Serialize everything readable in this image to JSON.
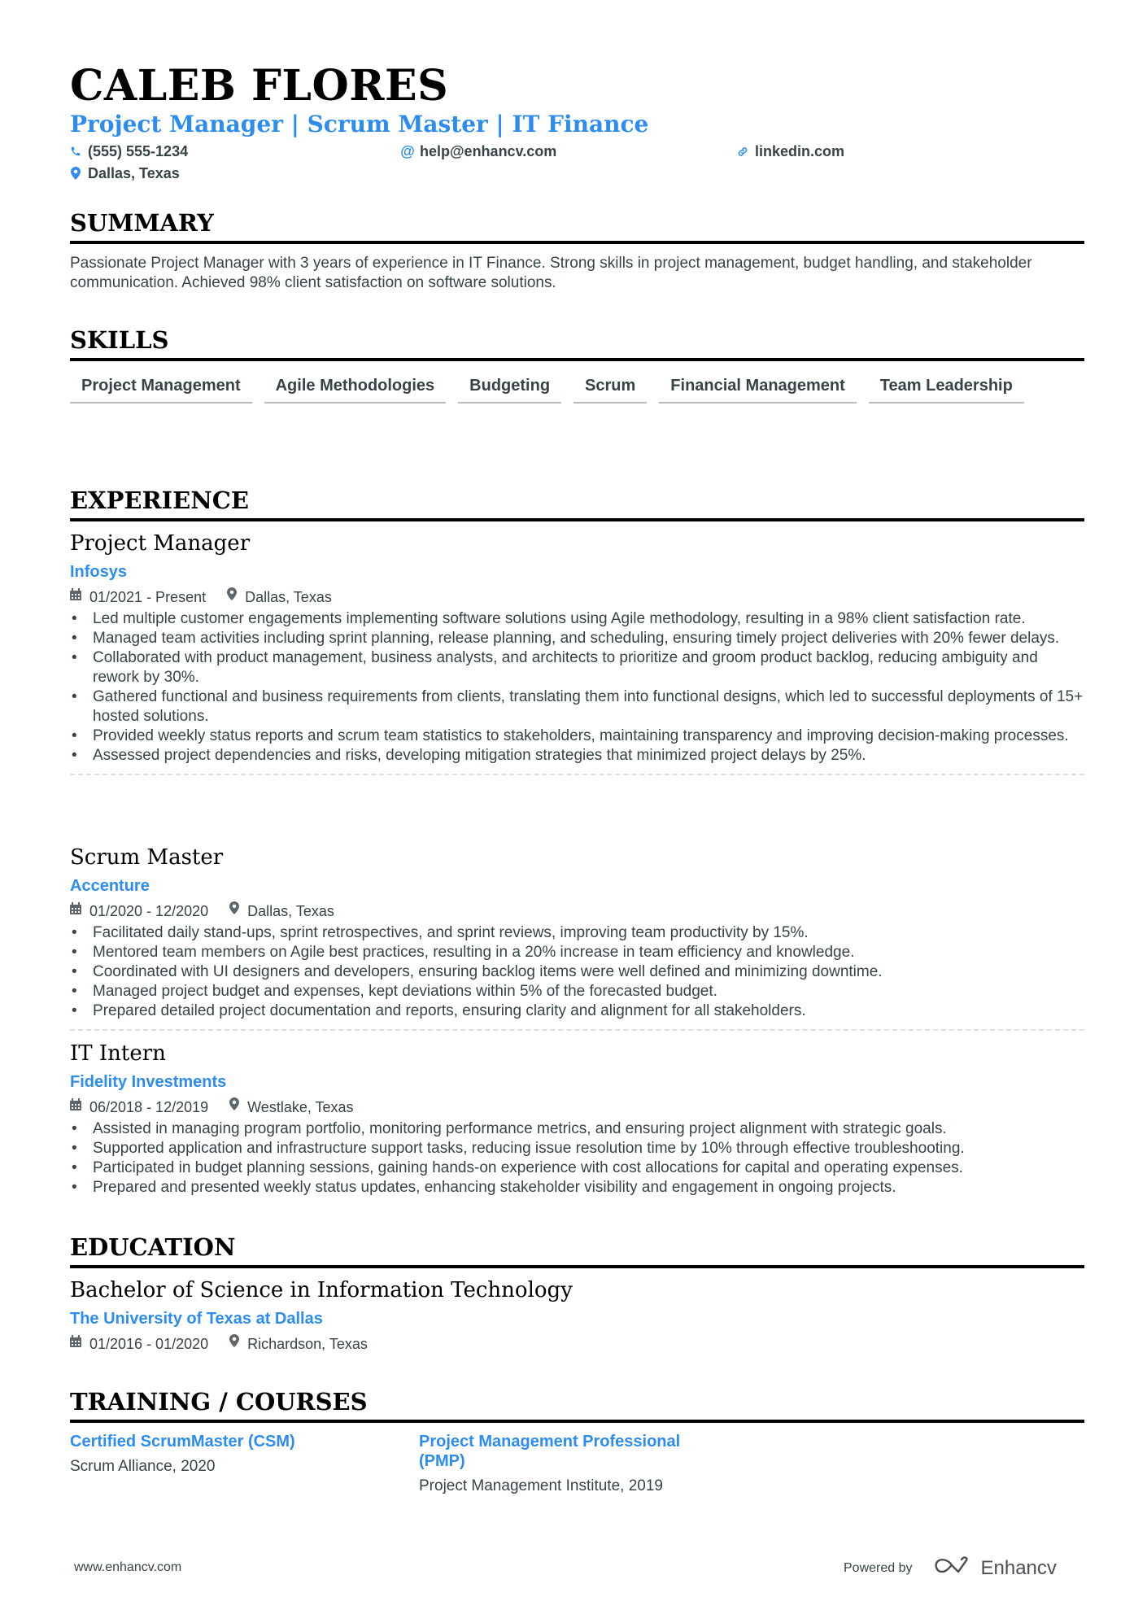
{
  "header": {
    "name": "CALEB FLORES",
    "title": "Project Manager | Scrum Master | IT Finance",
    "contacts": {
      "phone": "(555) 555-1234",
      "email": "help@enhancv.com",
      "linkedin": "linkedin.com",
      "location": "Dallas, Texas"
    }
  },
  "colors": {
    "accent": "#2d8cf0",
    "heading": "#000000",
    "text": "#384347"
  },
  "summary": {
    "heading": "SUMMARY",
    "text": "Passionate Project Manager with 3 years of experience in IT Finance. Strong skills in project management, budget handling, and stakeholder communication. Achieved 98% client satisfaction on software solutions."
  },
  "skills": {
    "heading": "SKILLS",
    "items": [
      "Project Management",
      "Agile Methodologies",
      "Budgeting",
      "Scrum",
      "Financial Management",
      "Team Leadership"
    ]
  },
  "experience": {
    "heading": "EXPERIENCE",
    "jobs": [
      {
        "title": "Project Manager",
        "company": "Infosys",
        "dates": "01/2021 - Present",
        "location": "Dallas, Texas",
        "bullets": [
          "Led multiple customer engagements implementing software solutions using Agile methodology, resulting in a 98% client satisfaction rate.",
          "Managed team activities including sprint planning, release planning, and scheduling, ensuring timely project deliveries with 20% fewer delays.",
          "Collaborated with product management, business analysts, and architects to prioritize and groom product backlog, reducing ambiguity and rework by 30%.",
          "Gathered functional and business requirements from clients, translating them into functional designs, which led to successful deployments of 15+ hosted solutions.",
          "Provided weekly status reports and scrum team statistics to stakeholders, maintaining transparency and improving decision-making processes.",
          "Assessed project dependencies and risks, developing mitigation strategies that minimized project delays by 25%."
        ]
      },
      {
        "title": "Scrum Master",
        "company": "Accenture",
        "dates": "01/2020 - 12/2020",
        "location": "Dallas, Texas",
        "bullets": [
          "Facilitated daily stand-ups, sprint retrospectives, and sprint reviews, improving team productivity by 15%.",
          "Mentored team members on Agile best practices, resulting in a 20% increase in team efficiency and knowledge.",
          "Coordinated with UI designers and developers, ensuring backlog items were well defined and minimizing downtime.",
          "Managed project budget and expenses, kept deviations within 5% of the forecasted budget.",
          "Prepared detailed project documentation and reports, ensuring clarity and alignment for all stakeholders."
        ]
      },
      {
        "title": "IT Intern",
        "company": "Fidelity Investments",
        "dates": "06/2018 - 12/2019",
        "location": "Westlake, Texas",
        "bullets": [
          "Assisted in managing program portfolio, monitoring performance metrics, and ensuring project alignment with strategic goals.",
          "Supported application and infrastructure support tasks, reducing issue resolution time by 10% through effective troubleshooting.",
          "Participated in budget planning sessions, gaining hands-on experience with cost allocations for capital and operating expenses.",
          "Prepared and presented weekly status updates, enhancing stakeholder visibility and engagement in ongoing projects."
        ]
      }
    ]
  },
  "education": {
    "heading": "EDUCATION",
    "degree": "Bachelor of Science in Information Technology",
    "school": "The University of Texas at Dallas",
    "dates": "01/2016 - 01/2020",
    "location": "Richardson, Texas"
  },
  "training": {
    "heading": "TRAINING / COURSES",
    "items": [
      {
        "title": "Certified ScrumMaster (CSM)",
        "source": "Scrum Alliance, 2020"
      },
      {
        "title": "Project Management Professional (PMP)",
        "source": "Project Management Institute, 2019"
      }
    ]
  },
  "footer": {
    "website": "www.enhancv.com",
    "powered_by": "Powered by",
    "brand": "Enhancv"
  }
}
